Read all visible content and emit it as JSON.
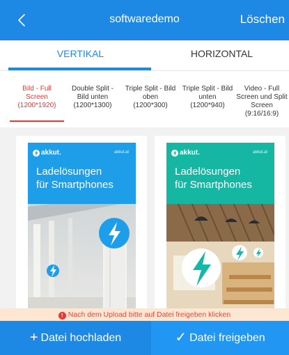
{
  "header": {
    "title": "softwaredemo",
    "delete_label": "Löschen"
  },
  "orientation_tabs": [
    {
      "label": "VERTIKAL",
      "active": true
    },
    {
      "label": "HORIZONTAL",
      "active": false
    }
  ],
  "layouts": [
    {
      "l1": "Bild - Full",
      "l2": "Screen",
      "l3": "",
      "dim": "(1200*1920)",
      "active": true
    },
    {
      "l1": "Double Split -",
      "l2": "Bild unten",
      "l3": "",
      "dim": "(1200*1300)",
      "active": false
    },
    {
      "l1": "Triple Split - Bild",
      "l2": "oben",
      "l3": "",
      "dim": "(1200*300)",
      "active": false
    },
    {
      "l1": "Triple Split - Bild",
      "l2": "unten",
      "l3": "",
      "dim": "(1200*940)",
      "active": false
    },
    {
      "l1": "Video - Full",
      "l2": "Screen und Split",
      "l3": "Screen",
      "dim": "(9:16/16:9)",
      "active": false
    }
  ],
  "posters": [
    {
      "brand": "akkut.",
      "site": "akkut.at",
      "headline_1": "Ladelösungen",
      "headline_2": "für Smartphones"
    },
    {
      "brand": "akkut.",
      "site": "akkut.at",
      "headline_1": "Ladelösungen",
      "headline_2": "für Smartphones"
    }
  ],
  "notice": {
    "icon": "!",
    "text": "Nach dem Upload bitte auf Datei freigeben klicken"
  },
  "actions": {
    "upload_icon": "+",
    "upload_label": "Datei hochladen",
    "release_icon": "✓",
    "release_label": "Datei freigeben"
  },
  "colors": {
    "primary": "#1e88e5",
    "active_tab_red": "#e53935",
    "notice_bg": "#fde6d2",
    "poster_blue": "#1e9ee8",
    "poster_teal": "#14b8a6"
  }
}
